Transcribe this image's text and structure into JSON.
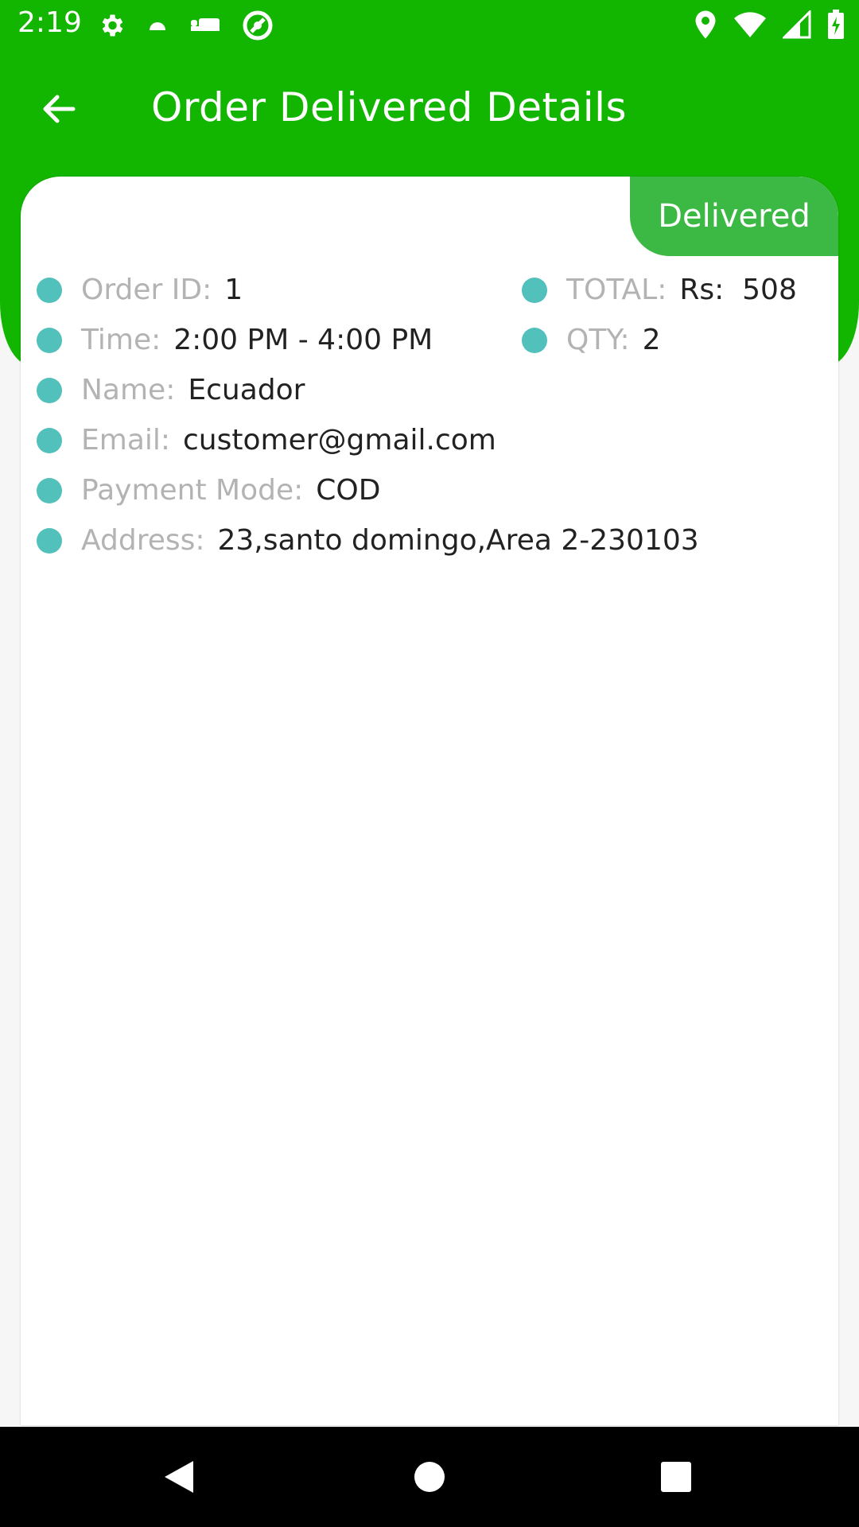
{
  "status_bar": {
    "time": "2:19",
    "left_icons": [
      "settings-icon",
      "android-icon",
      "bed-icon",
      "no-entry-icon"
    ],
    "right_icons": [
      "location-icon",
      "wifi-icon",
      "signal-icon",
      "battery-icon"
    ]
  },
  "header": {
    "title": "Order Delivered Details",
    "accent_color": "#12b500"
  },
  "order": {
    "status": "Delivered",
    "status_color": "#3cb944",
    "bullet_color": "#52c0bb",
    "fields": {
      "order_id": {
        "label": "Order ID:",
        "value": "1"
      },
      "total": {
        "label": "TOTAL:",
        "value": "Rs:  508"
      },
      "time": {
        "label": "Time:",
        "value": "2:00 PM - 4:00 PM"
      },
      "qty": {
        "label": "QTY:",
        "value": "2"
      },
      "name": {
        "label": "Name:",
        "value": "Ecuador"
      },
      "email": {
        "label": "Email:",
        "value": "customer@gmail.com"
      },
      "payment_mode": {
        "label": "Payment Mode:",
        "value": "COD"
      },
      "address": {
        "label": "Address:",
        "value": "23,santo domingo,Area 2-230103"
      }
    }
  },
  "nav": {
    "buttons": [
      "back-nav-icon",
      "home-nav-icon",
      "recents-nav-icon"
    ]
  }
}
